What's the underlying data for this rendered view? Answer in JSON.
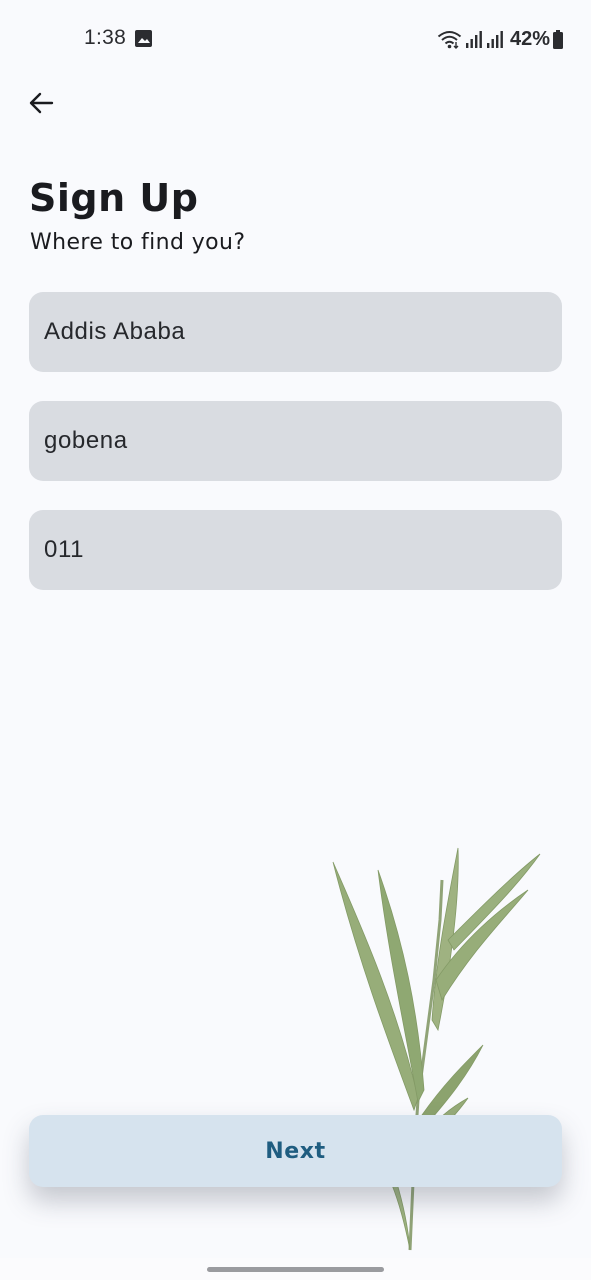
{
  "status_bar": {
    "time": "1:38",
    "battery": "42%",
    "icons": [
      "gallery-icon",
      "wifi-icon",
      "signal-icon",
      "battery-icon"
    ]
  },
  "header": {
    "back_icon": "arrow-left-icon",
    "title": "Sign Up",
    "subtitle": "Where to find you?"
  },
  "form": {
    "city": {
      "value": "Addis Ababa"
    },
    "area": {
      "value": "gobena"
    },
    "phone": {
      "value": "011"
    }
  },
  "actions": {
    "next_label": "Next"
  },
  "colors": {
    "background": "#f9fafd",
    "field_fill": "#d9dce1",
    "button_fill": "#d6e3ee",
    "button_text": "#1f5d80",
    "plant": "#7f9a5e"
  }
}
